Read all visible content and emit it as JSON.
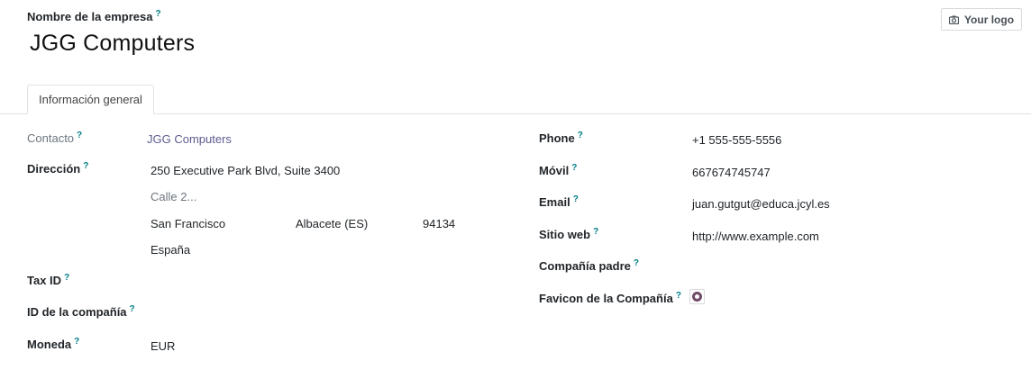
{
  "header": {
    "company_label": "Nombre de la empresa",
    "company_name": "JGG Computers",
    "logo_button": "Your logo"
  },
  "tabs": [
    {
      "label": "Información general"
    }
  ],
  "left": {
    "contact_label": "Contacto",
    "contact_value": "JGG Computers",
    "address_label": "Dirección",
    "street": "250 Executive Park Blvd, Suite 3400",
    "street2_placeholder": "Calle 2...",
    "city": "San Francisco",
    "state": "Albacete (ES)",
    "zip": "94134",
    "country": "España",
    "tax_id_label": "Tax ID",
    "company_id_label": "ID de la compañía",
    "currency_label": "Moneda",
    "currency_value": "EUR"
  },
  "right": {
    "phone_label": "Phone",
    "phone_value": "+1 555-555-5556",
    "mobile_label": "Móvil",
    "mobile_value": "667674745747",
    "email_label": "Email",
    "email_value": "juan.gutgut@educa.jcyl.es",
    "website_label": "Sitio web",
    "website_value": "http://www.example.com",
    "parent_label": "Compañía padre",
    "favicon_label": "Favicon de la Compañía"
  },
  "help_marker": "?",
  "colors": {
    "accent": "#017e84",
    "brand": "#714b67",
    "link": "#5b5b91"
  }
}
